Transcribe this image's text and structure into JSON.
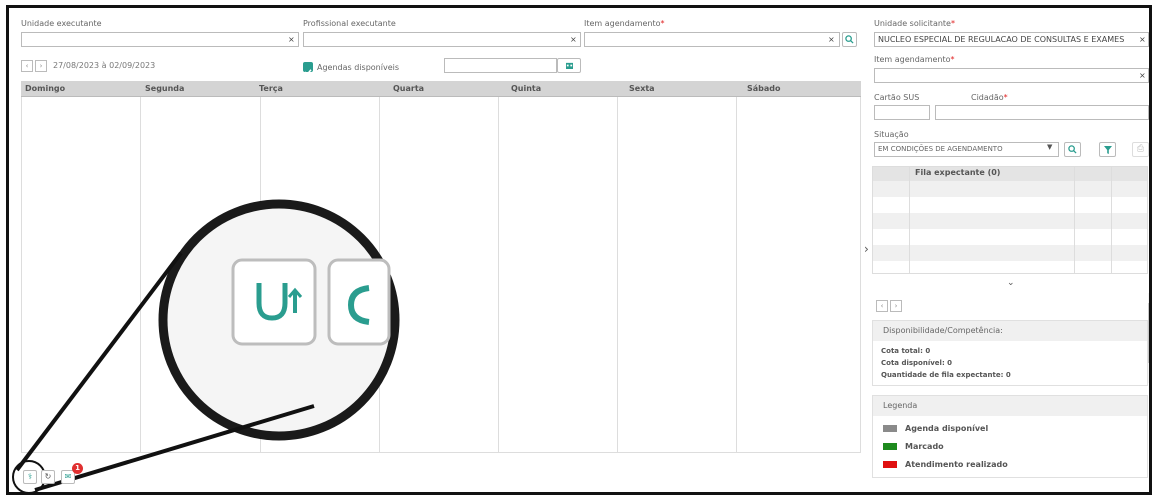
{
  "left": {
    "unidade_executante_label": "Unidade executante",
    "profissional_label": "Profissional executante",
    "item_label": "Item agendamento",
    "required_mark": "*",
    "clear_glyph": "×",
    "date_range": "27/08/2023 à 02/09/2023",
    "agendas_disponiveis_label": "Agendas disponíveis",
    "agendas_disponiveis_checked": true,
    "calendar_headers": [
      "Domingo",
      "Segunda",
      "Terça",
      "Quarta",
      "Quinta",
      "Sexta",
      "Sábado"
    ]
  },
  "right": {
    "unidade_solicitante_label": "Unidade solicitante",
    "unidade_solicitante_value": "NUCLEO ESPECIAL DE REGULACAO DE CONSULTAS E EXAMES",
    "item_label": "Item agendamento",
    "cartao_sus_label": "Cartão SUS",
    "cidadao_label": "Cidadão",
    "situacao_label": "Situação",
    "situacao_value": "EM CONDIÇÕES DE AGENDAMENTO",
    "fila_header": "Fila expectante (0)",
    "disponibilidade_title": "Disponibilidade/Competência:",
    "cota_total": "Cota total: 0",
    "cota_disponivel": "Cota disponível: 0",
    "qtd_fila": "Quantidade de fila expectante: 0",
    "legenda_title": "Legenda",
    "legend": [
      {
        "label": "Agenda disponível",
        "color": "#8a8a8a"
      },
      {
        "label": "Marcado",
        "color": "#1e8a1e"
      },
      {
        "label": "Atendimento realizado",
        "color": "#e01010"
      }
    ]
  },
  "toolbar": {
    "notification_count": "1"
  },
  "colors": {
    "accent": "#2a9d8f",
    "header_bg": "#d4d4d4",
    "required": "#e02020"
  }
}
